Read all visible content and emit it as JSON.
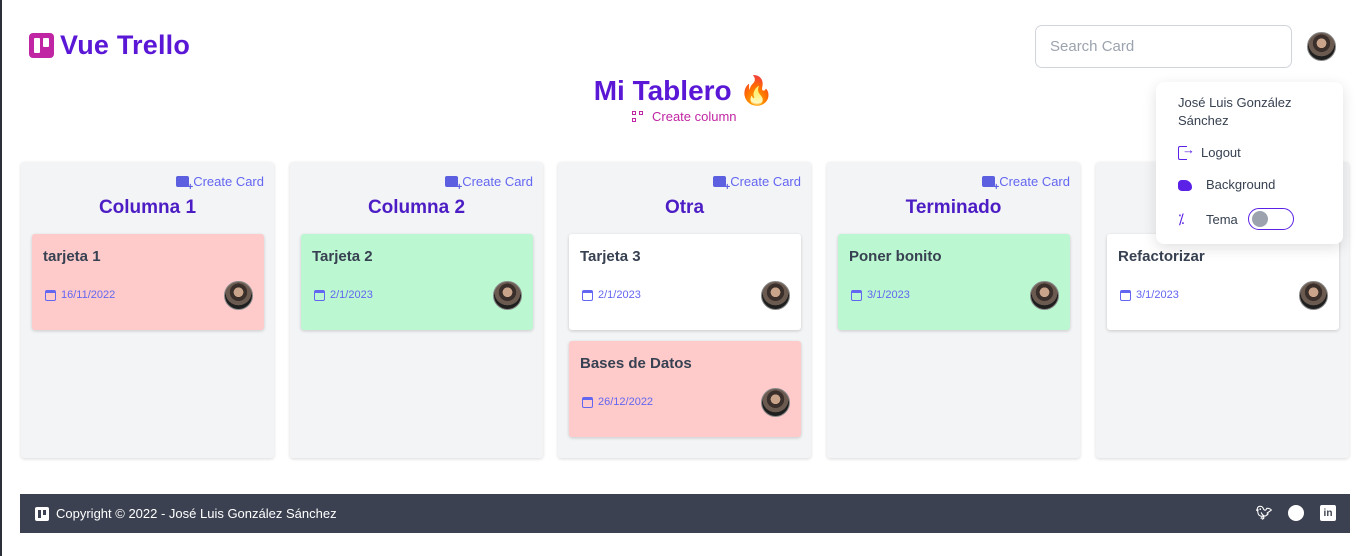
{
  "app": {
    "brand": "Vue Trello",
    "search_placeholder": "Search Card",
    "board_title": "Mi Tablero 🔥",
    "create_column_label": "Create column",
    "create_card_label": "Create Card"
  },
  "columns": [
    {
      "title": "Columna 1",
      "cards": [
        {
          "title": "tarjeta 1",
          "date": "16/11/2022",
          "color": "red"
        }
      ]
    },
    {
      "title": "Columna 2",
      "cards": [
        {
          "title": "Tarjeta 2",
          "date": "2/1/2023",
          "color": "green"
        }
      ]
    },
    {
      "title": "Otra",
      "cards": [
        {
          "title": "Tarjeta 3",
          "date": "2/1/2023",
          "color": "white"
        },
        {
          "title": "Bases de Datos",
          "date": "26/12/2022",
          "color": "red"
        }
      ]
    },
    {
      "title": "Terminado",
      "cards": [
        {
          "title": "Poner bonito",
          "date": "3/1/2023",
          "color": "green"
        }
      ]
    },
    {
      "title": "",
      "cards": [
        {
          "title": "Refactorizar",
          "date": "3/1/2023",
          "color": "white"
        }
      ]
    }
  ],
  "menu": {
    "user_name": "José Luis González Sánchez",
    "logout": "Logout",
    "background": "Background",
    "theme": "Tema",
    "theme_toggle_on": false
  },
  "footer": {
    "copyright": "Copyright © 2022 - José Luis González Sánchez",
    "social_icons": [
      "twitter-icon",
      "github-icon",
      "linkedin-icon"
    ]
  },
  "colors": {
    "accent": "#5a17d6",
    "magenta": "#c026a3",
    "card_red": "#fecaca",
    "card_green": "#bbf7d0",
    "footer_bg": "#3b4150"
  }
}
